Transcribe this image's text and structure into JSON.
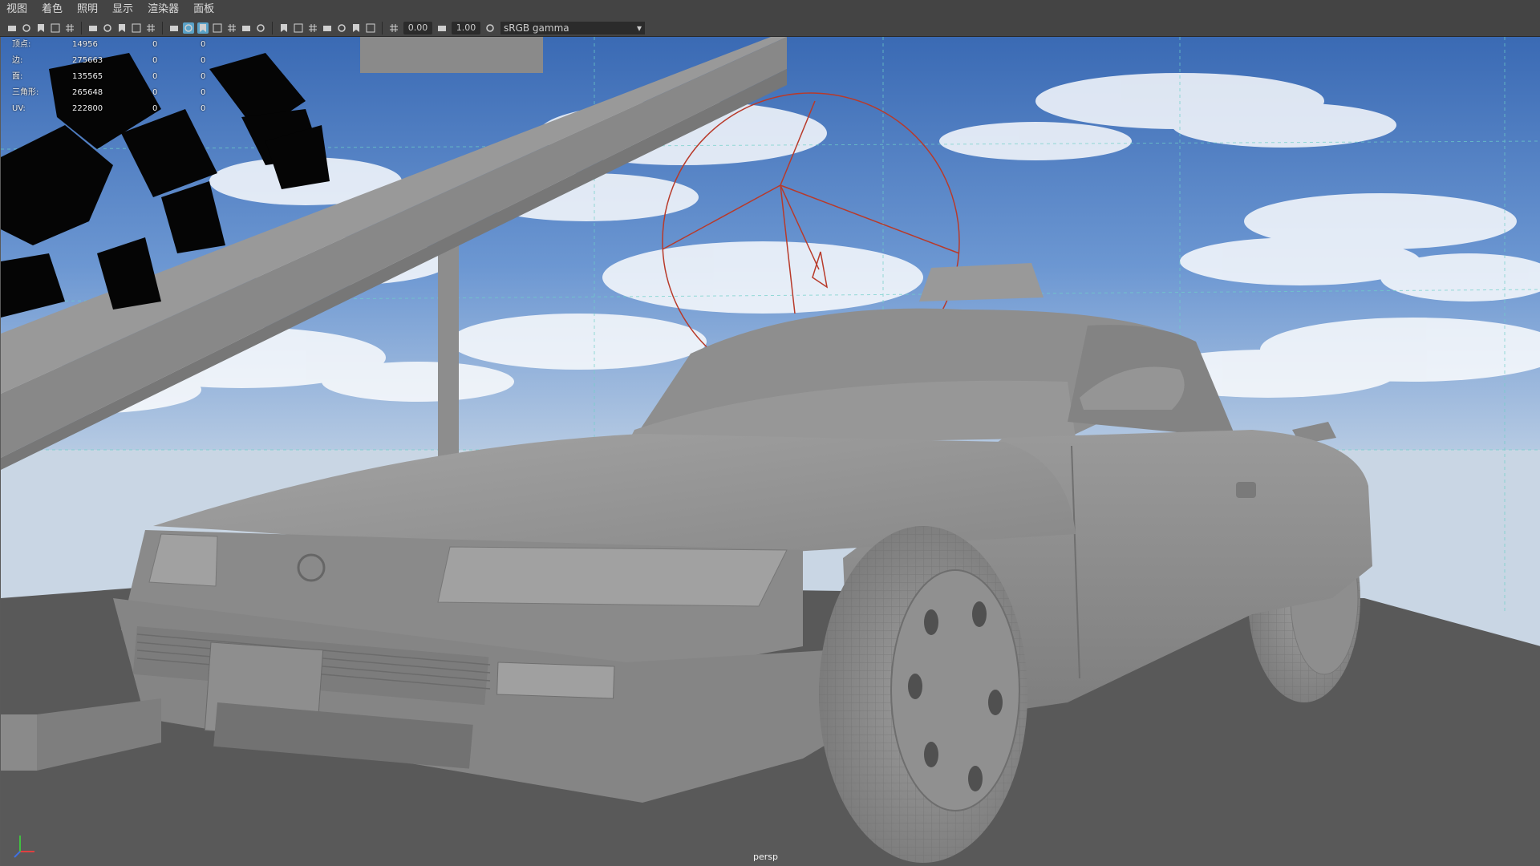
{
  "menu": [
    "视图",
    "着色",
    "照明",
    "显示",
    "渲染器",
    "面板"
  ],
  "toolbar": {
    "exposure": "0.00",
    "gamma": "1.00",
    "color_space": "sRGB gamma",
    "icons": [
      "camera-select-icon",
      "camera-attr-icon",
      "bookmark-icon",
      "image-plane-icon",
      "grid-icon",
      "film-gate-icon",
      "resolution-gate-icon",
      "gate-mask-icon",
      "field-chart-icon",
      "safe-action-icon",
      "wireframe-icon",
      "smooth-shade-icon",
      "wireframe-on-shaded-icon",
      "textured-icon",
      "use-all-lights-icon",
      "shadows-icon",
      "screen-space-ao-icon",
      "motion-blur-icon",
      "anti-alias-icon",
      "depth-of-field-icon",
      "isolate-select-icon",
      "xray-icon",
      "xray-joints-icon",
      "backface-icon",
      "exposure-icon",
      "gamma-icon",
      "color-management-icon"
    ]
  },
  "hud": {
    "rows": [
      {
        "label": "顶点:",
        "v1": "14956",
        "v2": "0",
        "v3": "0"
      },
      {
        "label": "边:",
        "v1": "275663",
        "v2": "0",
        "v3": "0"
      },
      {
        "label": "面:",
        "v1": "135565",
        "v2": "0",
        "v3": "0"
      },
      {
        "label": "三角形:",
        "v1": "265648",
        "v2": "0",
        "v3": "0"
      },
      {
        "label": "UV:",
        "v1": "222800",
        "v2": "0",
        "v3": "0"
      }
    ]
  },
  "camera_name": "persp",
  "colors": {
    "sky_top": "#3f6fb8",
    "sky_bottom": "#9fc0e6",
    "ground": "#595959",
    "car_body": "#8c8c8c",
    "light_gizmo": "#b83a2a",
    "grid_line": "#6fd0c8"
  }
}
